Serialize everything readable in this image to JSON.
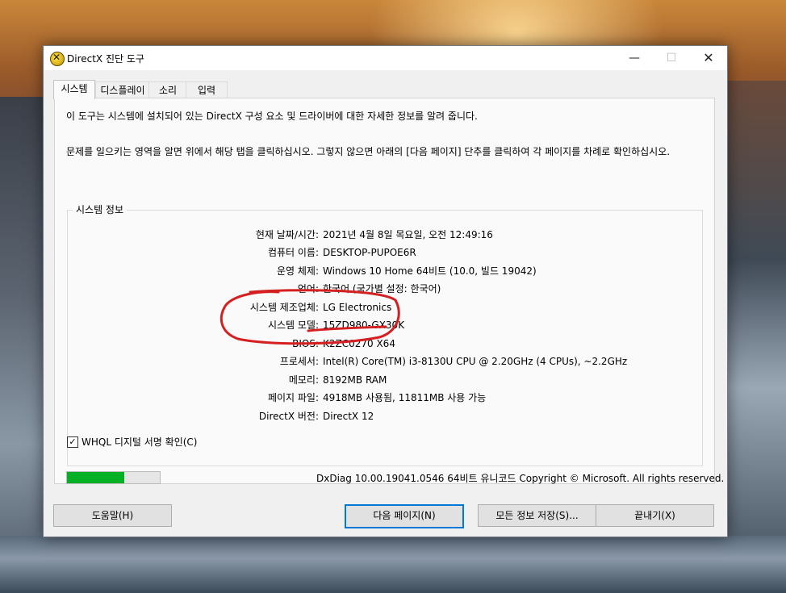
{
  "window": {
    "title": "DirectX 진단 도구",
    "minimize_glyph": "—",
    "maximize_glyph": "☐",
    "close_glyph": "✕"
  },
  "tabs": [
    {
      "label": "시스템",
      "active": true
    },
    {
      "label": "디스플레이",
      "active": false
    },
    {
      "label": "소리",
      "active": false
    },
    {
      "label": "입력",
      "active": false
    }
  ],
  "description": {
    "line1": "이 도구는 시스템에 설치되어 있는 DirectX 구성 요소 및 드라이버에 대한 자세한 정보를 알려 줍니다.",
    "line2": "문제를 일으키는 영역을 알면 위에서 해당 탭을 클릭하십시오. 그렇지 않으면 아래의 [다음 페이지] 단추를 클릭하여 각 페이지를 차례로 확인하십시오."
  },
  "system_info": {
    "group_title": "시스템 정보",
    "rows": [
      {
        "label": "현재 날짜/시간:",
        "value": "2021년 4월 8일 목요일, 오전 12:49:16"
      },
      {
        "label": "컴퓨터 이름:",
        "value": "DESKTOP-PUPOE6R"
      },
      {
        "label": "운영 체제:",
        "value": "Windows 10 Home 64비트 (10.0, 빌드 19042)"
      },
      {
        "label": "언어:",
        "value": "한국어 (국가별 설정: 한국어)"
      },
      {
        "label": "시스템 제조업체:",
        "value": "LG Electronics"
      },
      {
        "label": "시스템 모델:",
        "value": "15ZD980-GX30K"
      },
      {
        "label": "BIOS:",
        "value": "K2ZC0270 X64"
      },
      {
        "label": "프로세서:",
        "value": "Intel(R) Core(TM) i3-8130U CPU @ 2.20GHz (4 CPUs), ~2.2GHz"
      },
      {
        "label": "메모리:",
        "value": "8192MB RAM"
      },
      {
        "label": "페이지 파일:",
        "value": "4918MB 사용됨, 11811MB 사용 가능"
      },
      {
        "label": "DirectX 버전:",
        "value": "DirectX 12"
      }
    ]
  },
  "whql": {
    "label": "WHQL 디지털 서명 확인(C)",
    "checked": true,
    "check_glyph": "✓"
  },
  "progress": {
    "fraction": 0.62,
    "color": "#06b025"
  },
  "footer_text": "DxDiag 10.00.19041.0546 64비트 유니코드  Copyright © Microsoft. All rights reserved.",
  "buttons": {
    "help": "도움말(H)",
    "next": "다음 페이지(N)",
    "save": "모든 정보 저장(S)...",
    "exit": "끝내기(X)"
  },
  "annotation_color": "#d42020"
}
